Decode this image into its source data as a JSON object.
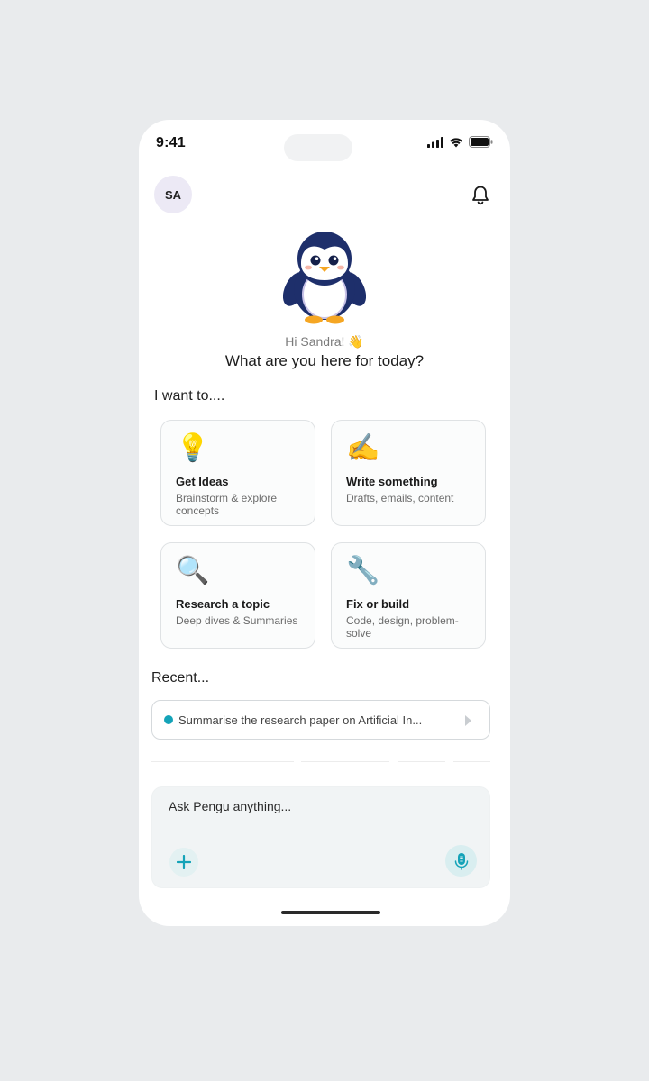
{
  "status": {
    "time": "9:41"
  },
  "header": {
    "avatar_initials": "SA",
    "bell_icon": "bell-icon",
    "mascot_icon": "penguin-mascot"
  },
  "hero": {
    "greeting": "Hi Sandra! 👋",
    "question": "What are you here for today?"
  },
  "intents": {
    "title": "I want to....",
    "cards": [
      {
        "emoji": "💡",
        "title": "Get Ideas",
        "subtitle": "Brainstorm & explore concepts"
      },
      {
        "emoji": "✍️",
        "title": "Write something",
        "subtitle": "Drafts, emails, content"
      },
      {
        "emoji": "🔍",
        "title": "Research a topic",
        "subtitle": "Deep dives & Summaries"
      },
      {
        "emoji": "🔧",
        "title": "Fix or build",
        "subtitle": "Code, design, problem-solve"
      }
    ]
  },
  "recent": {
    "title": "Recent...",
    "items": [
      {
        "text": "Summarise the research paper on Artificial In..."
      }
    ]
  },
  "composer": {
    "placeholder": "Ask Pengu anything...",
    "add_icon": "plus-icon",
    "mic_icon": "microphone-icon"
  },
  "colors": {
    "accent": "#14a3b8",
    "background": "#e9ebed",
    "card_border": "#dfe2e4"
  }
}
